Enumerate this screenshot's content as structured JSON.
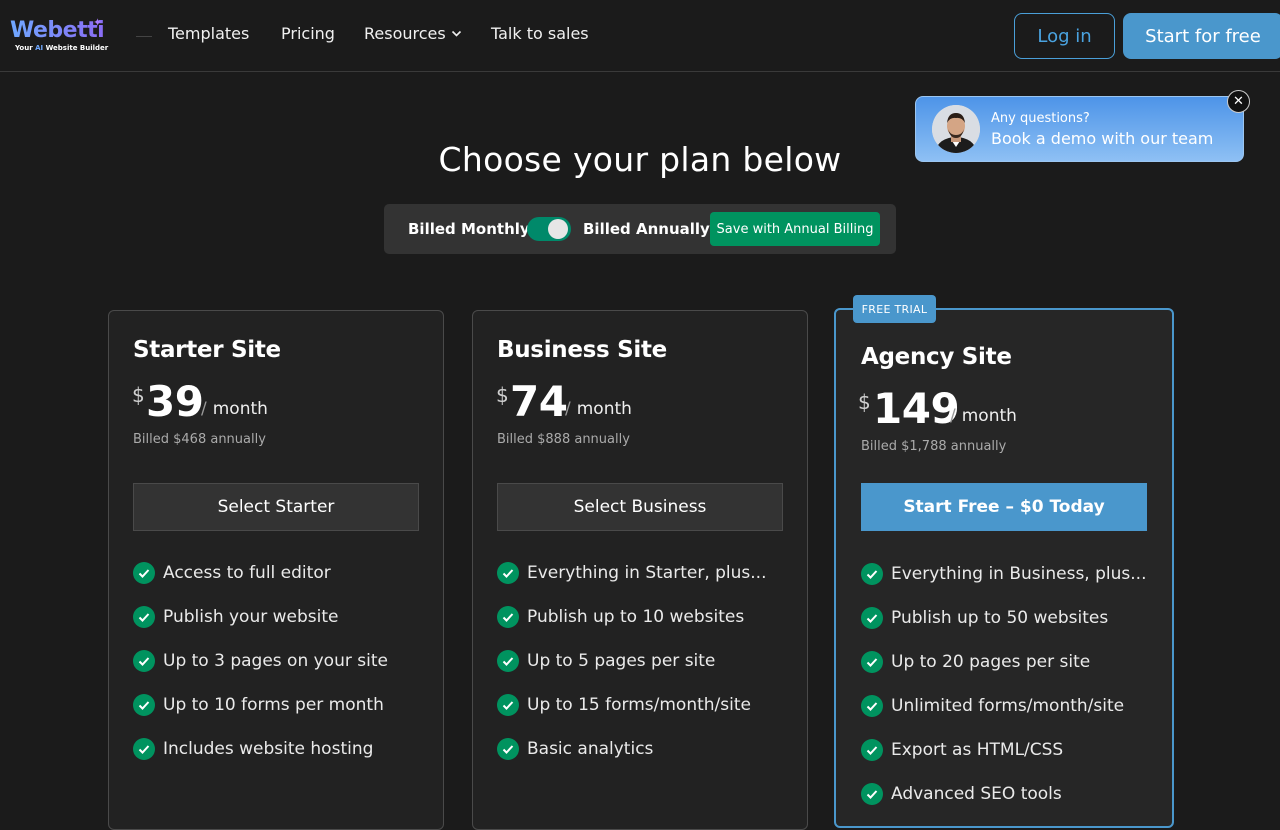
{
  "brand": {
    "name": "Webetti",
    "tagline_prefix": "Your ",
    "tagline_ai": "AI",
    "tagline_suffix": " Website Builder"
  },
  "nav": {
    "items": [
      "Templates",
      "Pricing",
      "Resources",
      "Talk to sales"
    ]
  },
  "header": {
    "login_label": "Log in",
    "start_label": "Start for free"
  },
  "demo": {
    "question": "Any questions?",
    "title": "Book a demo with our team",
    "close": "✕"
  },
  "page": {
    "headline": "Choose your plan below"
  },
  "billing": {
    "monthly": "Billed Monthly",
    "annually": "Billed Annually",
    "save": "Save with Annual Billing",
    "annual_selected": true
  },
  "plans": [
    {
      "name": "Starter Site",
      "currency": "$",
      "amount": "39",
      "period": "month",
      "billed": "Billed $468 annually",
      "cta": "Select Starter",
      "features": [
        "Access to full editor",
        "Publish your website",
        "Up to 3 pages on your site",
        "Up to 10 forms per month",
        "Includes website hosting"
      ]
    },
    {
      "name": "Business Site",
      "currency": "$",
      "amount": "74",
      "period": "month",
      "billed": "Billed $888 annually",
      "cta": "Select Business",
      "features": [
        "Everything in Starter, plus...",
        "Publish up to 10 websites",
        "Up to 5 pages per site",
        "Up to 15 forms/month/site",
        "Basic analytics"
      ]
    },
    {
      "name": "Agency Site",
      "badge": "FREE TRIAL",
      "currency": "$",
      "amount": "149",
      "period": "month",
      "billed": "Billed $1,788 annually",
      "cta": "Start Free – $0 Today",
      "features": [
        "Everything in Business, plus...",
        "Publish up to 50 websites",
        "Up to 20 pages per site",
        "Unlimited forms/month/site",
        "Export as HTML/CSS",
        "Advanced SEO tools"
      ]
    }
  ],
  "colors": {
    "accent": "#4a97cc",
    "success": "#00935f",
    "background": "#1b1b1b"
  }
}
